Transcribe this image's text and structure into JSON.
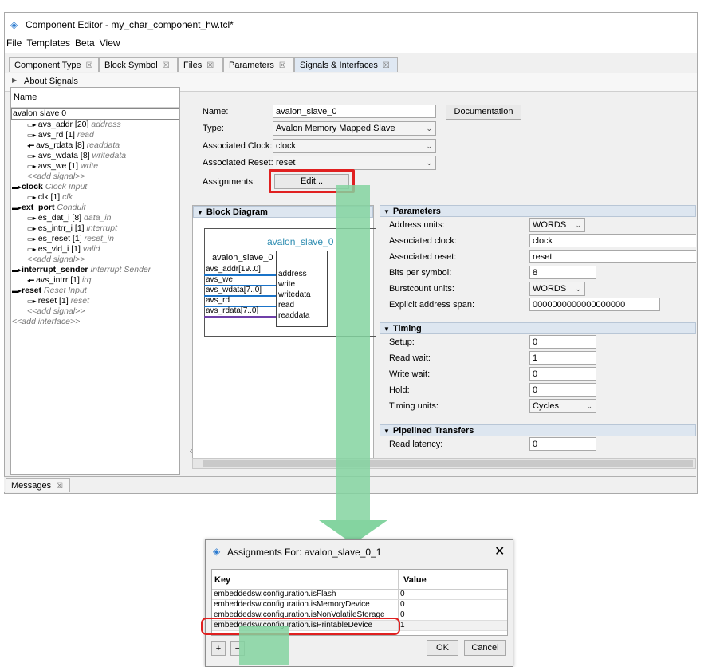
{
  "window": {
    "title": "Component Editor - my_char_component_hw.tcl*"
  },
  "menu": [
    "File",
    "Templates",
    "Beta",
    "View"
  ],
  "tabs": [
    "Component Type",
    "Block Symbol",
    "Files",
    "Parameters",
    "Signals & Interfaces"
  ],
  "about": "About Signals",
  "tree": {
    "header": "Name",
    "rows": [
      {
        "name": "avalon slave 0",
        "type": "",
        "level": 0,
        "icon": "",
        "bold": false
      },
      {
        "name": "avs_addr [20]",
        "type": "address",
        "level": 1,
        "icon": "out"
      },
      {
        "name": "avs_rd [1]",
        "type": "read",
        "level": 1,
        "icon": "out"
      },
      {
        "name": "avs_rdata [8]",
        "type": "readdata",
        "level": 1,
        "icon": "in"
      },
      {
        "name": "avs_wdata [8]",
        "type": "writedata",
        "level": 1,
        "icon": "out"
      },
      {
        "name": "avs_we [1]",
        "type": "write",
        "level": 1,
        "icon": "out"
      },
      {
        "name": "",
        "type": "<<add signal>>",
        "level": 1,
        "icon": ""
      },
      {
        "name": "clock",
        "type": "Clock Input",
        "level": 0,
        "icon": "iface",
        "bold": true
      },
      {
        "name": "clk [1]",
        "type": "clk",
        "level": 1,
        "icon": "out"
      },
      {
        "name": "ext_port",
        "type": "Conduit",
        "level": 0,
        "icon": "iface",
        "bold": true
      },
      {
        "name": "es_dat_i [8]",
        "type": "data_in",
        "level": 1,
        "icon": "out"
      },
      {
        "name": "es_intrr_i [1]",
        "type": "interrupt",
        "level": 1,
        "icon": "out"
      },
      {
        "name": "es_reset [1]",
        "type": "reset_in",
        "level": 1,
        "icon": "out"
      },
      {
        "name": "es_vld_i [1]",
        "type": "valid",
        "level": 1,
        "icon": "out"
      },
      {
        "name": "",
        "type": "<<add signal>>",
        "level": 1,
        "icon": ""
      },
      {
        "name": "interrupt_sender",
        "type": "Interrupt Sender",
        "level": 0,
        "icon": "iface",
        "bold": true
      },
      {
        "name": "avs_intrr [1]",
        "type": "irq",
        "level": 1,
        "icon": "in"
      },
      {
        "name": "reset",
        "type": "Reset Input",
        "level": 0,
        "icon": "iface",
        "bold": true
      },
      {
        "name": "reset [1]",
        "type": "reset",
        "level": 1,
        "icon": "out"
      },
      {
        "name": "",
        "type": "<<add signal>>",
        "level": 1,
        "icon": ""
      },
      {
        "name": "",
        "type": "<<add interface>>",
        "level": 0,
        "icon": ""
      }
    ]
  },
  "form": {
    "name_label": "Name:",
    "name_value": "avalon_slave_0",
    "type_label": "Type:",
    "type_value": "Avalon Memory Mapped Slave",
    "clock_label": "Associated Clock:",
    "clock_value": "clock",
    "reset_label": "Associated Reset:",
    "reset_value": "reset",
    "assign_label": "Assignments:",
    "edit_button": "Edit...",
    "doc_button": "Documentation"
  },
  "block": {
    "title": "Block Diagram",
    "iface_label": "avalon_slave_0",
    "box_label": "avalon_slave_0",
    "ports": [
      {
        "ext": "avs_addr[19..0]",
        "int": "address"
      },
      {
        "ext": "avs_we",
        "int": "write"
      },
      {
        "ext": "avs_wdata[7..0]",
        "int": "writedata"
      },
      {
        "ext": "avs_rd",
        "int": "read"
      },
      {
        "ext": "avs_rdata[7..0]",
        "int": "readdata"
      }
    ]
  },
  "params": {
    "title": "Parameters",
    "rows": [
      {
        "label": "Address units:",
        "value": "WORDS",
        "kind": "combo"
      },
      {
        "label": "Associated clock:",
        "value": "clock",
        "kind": "field"
      },
      {
        "label": "Associated reset:",
        "value": "reset",
        "kind": "field"
      },
      {
        "label": "Bits per symbol:",
        "value": "8",
        "kind": "field"
      },
      {
        "label": "Burstcount units:",
        "value": "WORDS",
        "kind": "combo"
      },
      {
        "label": "Explicit address span:",
        "value": "0000000000000000000",
        "kind": "field"
      }
    ],
    "timing_title": "Timing",
    "timing": [
      {
        "label": "Setup:",
        "value": "0",
        "kind": "field"
      },
      {
        "label": "Read wait:",
        "value": "1",
        "kind": "field"
      },
      {
        "label": "Write wait:",
        "value": "0",
        "kind": "field"
      },
      {
        "label": "Hold:",
        "value": "0",
        "kind": "field"
      },
      {
        "label": "Timing units:",
        "value": "Cycles",
        "kind": "combo"
      }
    ],
    "pipe_title": "Pipelined Transfers",
    "pipe": [
      {
        "label": "Read latency:",
        "value": "0",
        "kind": "field"
      }
    ]
  },
  "messages": "Messages",
  "dialog": {
    "title": "Assignments For: avalon_slave_0_1",
    "col_key": "Key",
    "col_value": "Value",
    "rows": [
      {
        "key": "embeddedsw.configuration.isFlash",
        "value": "0"
      },
      {
        "key": "embeddedsw.configuration.isMemoryDevice",
        "value": "0"
      },
      {
        "key": "embeddedsw.configuration.isNonVolatileStorage",
        "value": "0"
      },
      {
        "key": "embeddedsw.configuration.isPrintableDevice",
        "value": "1"
      }
    ],
    "add": "+",
    "remove": "−",
    "ok": "OK",
    "cancel": "Cancel"
  },
  "colors": {
    "highlight": "#e02020",
    "arrow": "#84d4a0",
    "accent": "#1a73c8"
  }
}
